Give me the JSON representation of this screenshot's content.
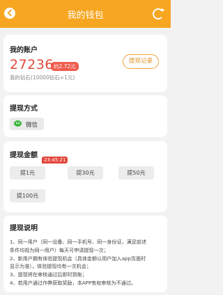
{
  "header": {
    "title": "我的钱包",
    "back_icon": "chevron-left-icon",
    "refresh_icon": "refresh-icon",
    "color": "#f7a621"
  },
  "account": {
    "title": "我的账户",
    "amount": "27236",
    "rmb_badge": "约2.72元",
    "rate_text": "我的钻石(10000钻石=1元)",
    "record_button": "提现记录"
  },
  "method": {
    "title": "提现方式",
    "wechat_label": "微信"
  },
  "withdraw": {
    "title": "提现金额",
    "timer": "23:45:21",
    "options": [
      "提1元",
      "提30元",
      "提50元",
      "提100元"
    ]
  },
  "notes": {
    "title": "提现说明",
    "lines": [
      "1、同一用户（同一设备、同一手机号、同一身份证，满足前述",
      "条件均视为同一用户）每天可申请提现一次；",
      "2、新用户拥有体验提现机会（具体金额以用户加入app页面时",
      "显示为准），体验提现均有一次机会；",
      "3、提现将在审核通过后即时到账；",
      "4、若用户通过作弊获取奖励，本APP有权审核为不通过。"
    ]
  }
}
